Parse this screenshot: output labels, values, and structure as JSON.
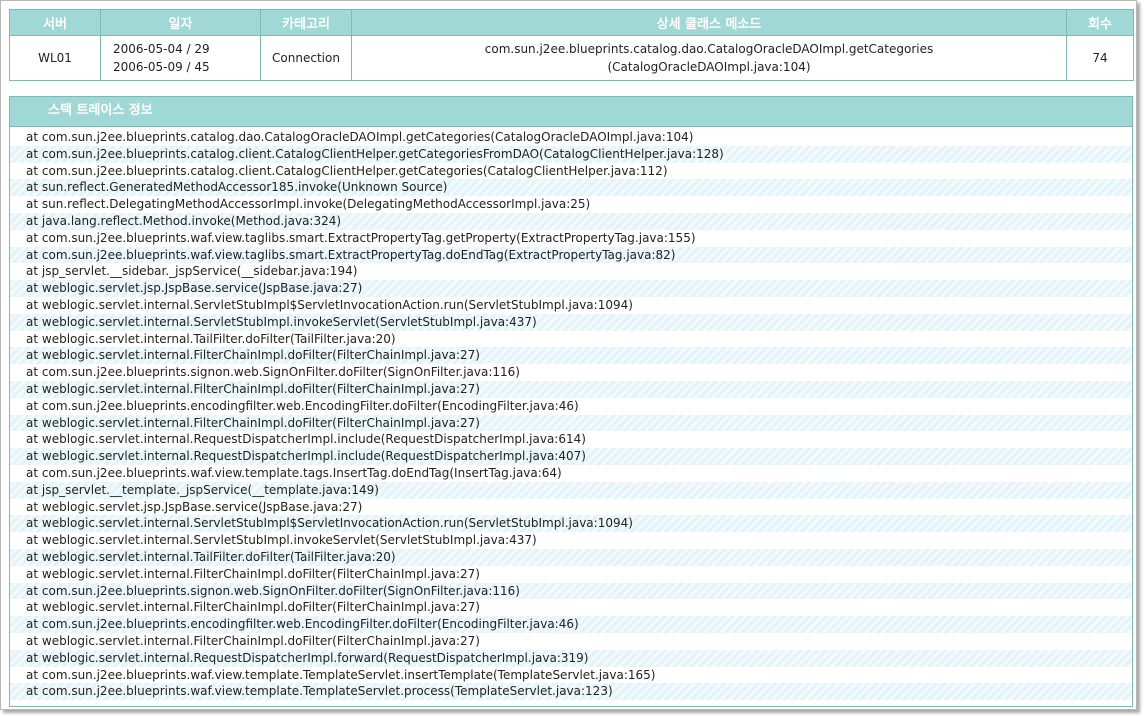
{
  "summary": {
    "headers": {
      "server": "서버",
      "date": "일자",
      "category": "카테고리",
      "method": "상세 클래스 메소드",
      "count": "회수"
    },
    "row": {
      "server": "WL01",
      "date_line1": "2006-05-04 / 29",
      "date_line2": "2006-05-09 / 45",
      "category": "Connection",
      "method_line1": "com.sun.j2ee.blueprints.catalog.dao.CatalogOracleDAOImpl.getCategories",
      "method_line2": "(CatalogOracleDAOImpl.java:104)",
      "count": "74"
    }
  },
  "trace": {
    "title": "스택 트레이스 정보",
    "lines": [
      "at com.sun.j2ee.blueprints.catalog.dao.CatalogOracleDAOImpl.getCategories(CatalogOracleDAOImpl.java:104)",
      "at com.sun.j2ee.blueprints.catalog.client.CatalogClientHelper.getCategoriesFromDAO(CatalogClientHelper.java:128)",
      "at com.sun.j2ee.blueprints.catalog.client.CatalogClientHelper.getCategories(CatalogClientHelper.java:112)",
      "at sun.reflect.GeneratedMethodAccessor185.invoke(Unknown Source)",
      "at sun.reflect.DelegatingMethodAccessorImpl.invoke(DelegatingMethodAccessorImpl.java:25)",
      "at java.lang.reflect.Method.invoke(Method.java:324)",
      "at com.sun.j2ee.blueprints.waf.view.taglibs.smart.ExtractPropertyTag.getProperty(ExtractPropertyTag.java:155)",
      "at com.sun.j2ee.blueprints.waf.view.taglibs.smart.ExtractPropertyTag.doEndTag(ExtractPropertyTag.java:82)",
      "at jsp_servlet.__sidebar._jspService(__sidebar.java:194)",
      "at weblogic.servlet.jsp.JspBase.service(JspBase.java:27)",
      "at weblogic.servlet.internal.ServletStubImpl$ServletInvocationAction.run(ServletStubImpl.java:1094)",
      "at weblogic.servlet.internal.ServletStubImpl.invokeServlet(ServletStubImpl.java:437)",
      "at weblogic.servlet.internal.TailFilter.doFilter(TailFilter.java:20)",
      "at weblogic.servlet.internal.FilterChainImpl.doFilter(FilterChainImpl.java:27)",
      "at com.sun.j2ee.blueprints.signon.web.SignOnFilter.doFilter(SignOnFilter.java:116)",
      "at weblogic.servlet.internal.FilterChainImpl.doFilter(FilterChainImpl.java:27)",
      "at com.sun.j2ee.blueprints.encodingfilter.web.EncodingFilter.doFilter(EncodingFilter.java:46)",
      "at weblogic.servlet.internal.FilterChainImpl.doFilter(FilterChainImpl.java:27)",
      "at weblogic.servlet.internal.RequestDispatcherImpl.include(RequestDispatcherImpl.java:614)",
      "at weblogic.servlet.internal.RequestDispatcherImpl.include(RequestDispatcherImpl.java:407)",
      "at com.sun.j2ee.blueprints.waf.view.template.tags.InsertTag.doEndTag(InsertTag.java:64)",
      "at jsp_servlet.__template._jspService(__template.java:149)",
      "at weblogic.servlet.jsp.JspBase.service(JspBase.java:27)",
      "at weblogic.servlet.internal.ServletStubImpl$ServletInvocationAction.run(ServletStubImpl.java:1094)",
      "at weblogic.servlet.internal.ServletStubImpl.invokeServlet(ServletStubImpl.java:437)",
      "at weblogic.servlet.internal.TailFilter.doFilter(TailFilter.java:20)",
      "at weblogic.servlet.internal.FilterChainImpl.doFilter(FilterChainImpl.java:27)",
      "at com.sun.j2ee.blueprints.signon.web.SignOnFilter.doFilter(SignOnFilter.java:116)",
      "at weblogic.servlet.internal.FilterChainImpl.doFilter(FilterChainImpl.java:27)",
      "at com.sun.j2ee.blueprints.encodingfilter.web.EncodingFilter.doFilter(EncodingFilter.java:46)",
      "at weblogic.servlet.internal.FilterChainImpl.doFilter(FilterChainImpl.java:27)",
      "at weblogic.servlet.internal.RequestDispatcherImpl.forward(RequestDispatcherImpl.java:319)",
      "at com.sun.j2ee.blueprints.waf.view.template.TemplateServlet.insertTemplate(TemplateServlet.java:165)",
      "at com.sun.j2ee.blueprints.waf.view.template.TemplateServlet.process(TemplateServlet.java:123)"
    ]
  },
  "colors": {
    "header_bg": "#9fd8d5",
    "border": "#7fb8b5",
    "stripe": "#e4f3f8"
  }
}
